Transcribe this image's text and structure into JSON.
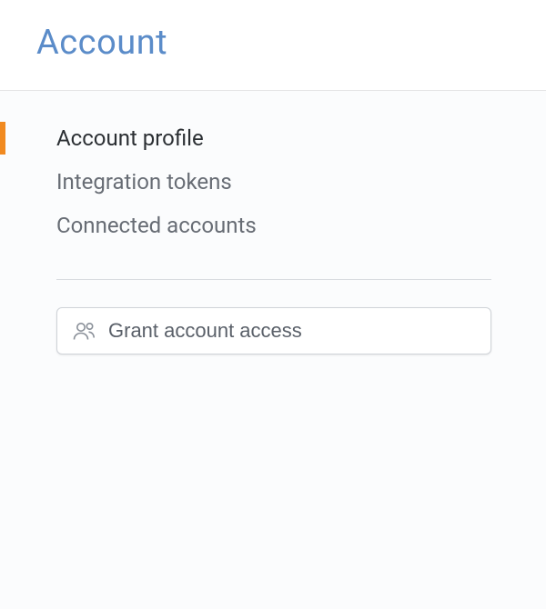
{
  "header": {
    "title": "Account"
  },
  "nav": {
    "items": [
      {
        "label": "Account profile",
        "active": true
      },
      {
        "label": "Integration tokens",
        "active": false
      },
      {
        "label": "Connected accounts",
        "active": false
      }
    ]
  },
  "action": {
    "label": "Grant account access"
  },
  "colors": {
    "accent": "#f18a20",
    "headerText": "#5b8cc9"
  }
}
